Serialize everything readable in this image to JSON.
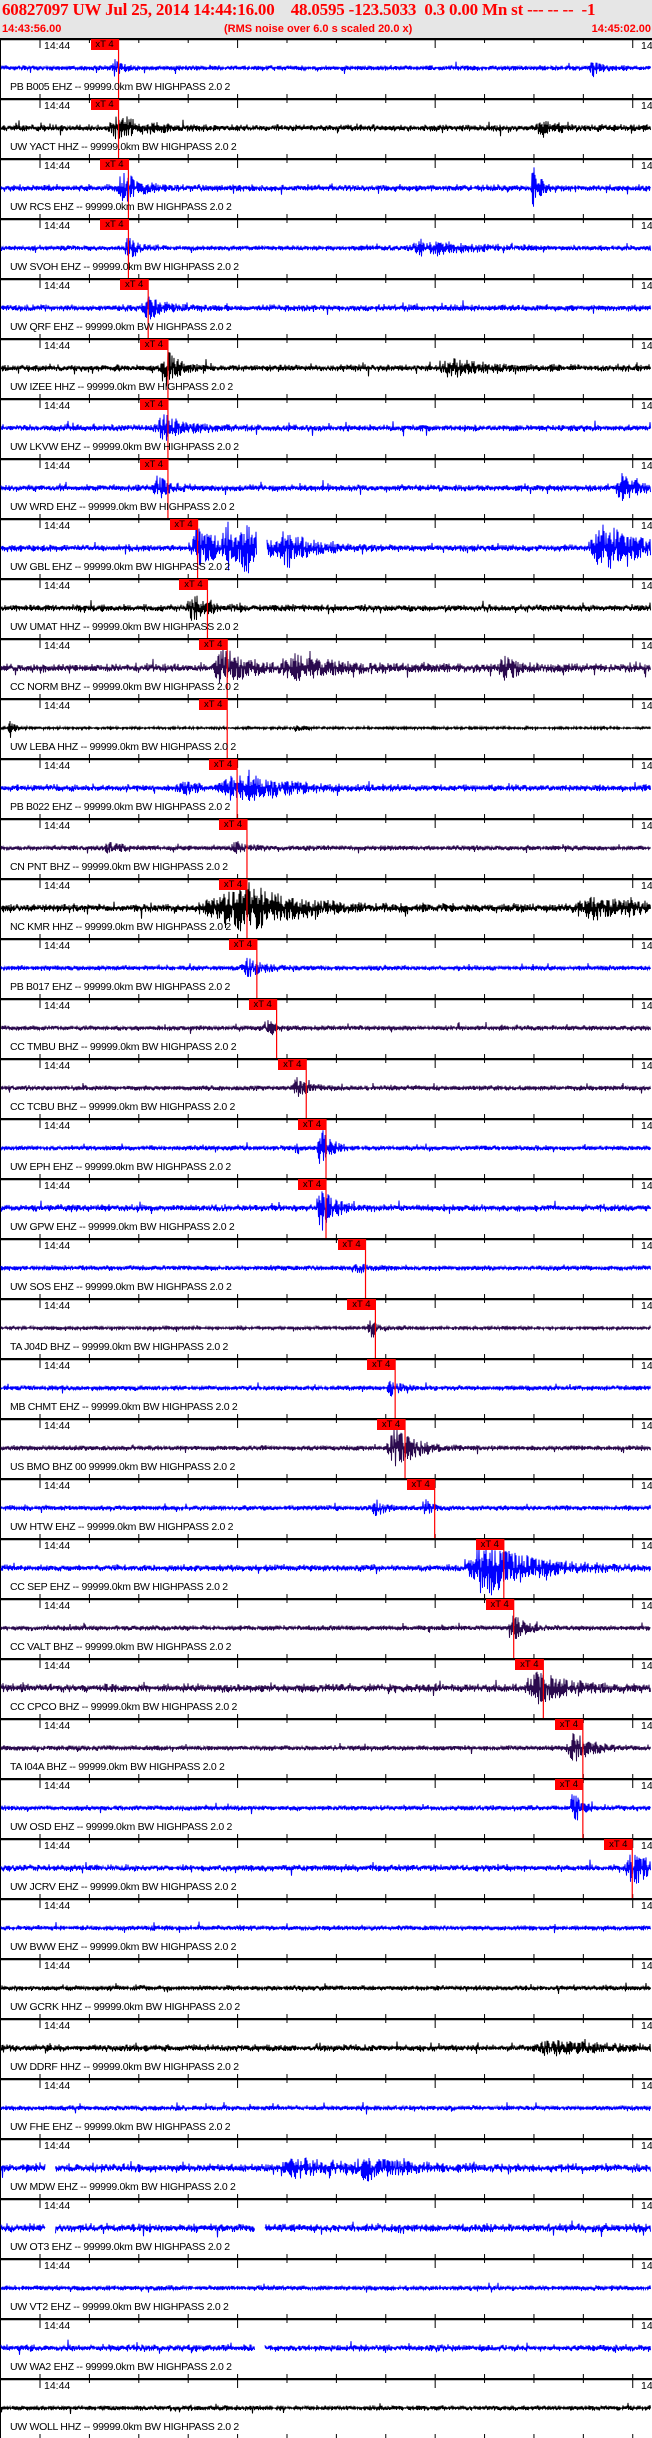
{
  "header": {
    "title": "60827097 UW Jul 25, 2014 14:44:16.00    48.0595 -123.5033  0.3 0.00 Mn st --- -- --  -1",
    "start_time": "14:43:56.00",
    "note": "(RMS noise over 6.0 s scaled 20.0 x)",
    "end_time": "14:45:02.00"
  },
  "colors": {
    "blue": "#0000ff",
    "black": "#000000",
    "purple": "#2a0a4e",
    "pick": "#ff0000",
    "header_bg": "#e6e6e6"
  },
  "chart_data": {
    "type": "line",
    "title": "60827097 UW Jul 25, 2014 14:44:16.00",
    "x_range_s": [
      0,
      66
    ],
    "x_start": "14:43:56.00",
    "x_end": "14:45:02.00",
    "tick_interval_s": 5,
    "tick_label": "14:44",
    "right_tick_label": "14:",
    "pick_label": "xT 4",
    "traces": [
      {
        "label": "PB B005 EHZ -- 99999.0km BW HIGHPASS 2.0 2",
        "color": "blue",
        "pick_s": 12,
        "noise": 3,
        "events": [
          [
            11.5,
            9,
            1
          ],
          [
            60,
            7,
            1
          ]
        ]
      },
      {
        "label": "UW YACT HHZ -- 99999.0km BW HIGHPASS 2.0 2",
        "color": "black",
        "pick_s": 12,
        "noise": 4,
        "events": [
          [
            12,
            11,
            3
          ],
          [
            55,
            6,
            2
          ]
        ]
      },
      {
        "label": "UW RCS EHZ -- 99999.0km BW HIGHPASS 2.0 2",
        "color": "blue",
        "pick_s": 13,
        "noise": 4,
        "events": [
          [
            12.5,
            14,
            2
          ],
          [
            54,
            22,
            0.8
          ]
        ]
      },
      {
        "label": "UW SVOH EHZ -- 99999.0km BW HIGHPASS 2.0 2",
        "color": "blue",
        "pick_s": 13,
        "noise": 3,
        "events": [
          [
            13,
            10,
            1.5
          ],
          [
            43,
            6,
            6
          ]
        ]
      },
      {
        "label": "UW QRF EHZ -- 99999.0km BW HIGHPASS 2.0 2",
        "color": "blue",
        "pick_s": 15,
        "noise": 4,
        "events": [
          [
            15,
            10,
            2
          ]
        ]
      },
      {
        "label": "UW IZEE HHZ -- 99999.0km BW HIGHPASS 2.0 2",
        "color": "black",
        "pick_s": 17,
        "noise": 4,
        "events": [
          [
            16.8,
            18,
            1.5
          ],
          [
            46,
            8,
            4
          ]
        ]
      },
      {
        "label": "UW LKVW EHZ -- 99999.0km BW HIGHPASS 2.0 2",
        "color": "blue",
        "pick_s": 17,
        "noise": 4,
        "events": [
          [
            16.5,
            12,
            2.5
          ]
        ]
      },
      {
        "label": "UW WRD EHZ -- 99999.0km BW HIGHPASS 2.0 2",
        "color": "blue",
        "pick_s": 17,
        "noise": 4,
        "events": [
          [
            16,
            11,
            1.5
          ],
          [
            63,
            12,
            2
          ]
        ]
      },
      {
        "label": "UW GBL EHZ -- 99999.0km BW HIGHPASS 2.0 2",
        "color": "blue",
        "pick_s": 20,
        "noise": 4,
        "events": [
          [
            20,
            25,
            2
          ],
          [
            23,
            20,
            2
          ],
          [
            25,
            22,
            2
          ],
          [
            29,
            15,
            3
          ],
          [
            61,
            25,
            4
          ]
        ],
        "gaps": [
          [
            26,
            27
          ]
        ]
      },
      {
        "label": "UW UMAT HHZ -- 99999.0km BW HIGHPASS 2.0 2",
        "color": "black",
        "pick_s": 21,
        "noise": 4,
        "events": [
          [
            19.5,
            13,
            2
          ]
        ]
      },
      {
        "label": "CC NORM BHZ -- 99999.0km BW HIGHPASS 2.0 2",
        "color": "purple",
        "pick_s": 23,
        "noise": 5,
        "events": [
          [
            22.5,
            18,
            3
          ],
          [
            30,
            10,
            5
          ],
          [
            51,
            10,
            2
          ]
        ]
      },
      {
        "label": "UW LEBA HHZ -- 99999.0km BW HIGHPASS 2.0 2",
        "color": "black",
        "pick_s": 23,
        "noise": 1.5,
        "events": [
          [
            1,
            10,
            0.5
          ],
          [
            30,
            3,
            1
          ]
        ]
      },
      {
        "label": "PB B022 EHZ -- 99999.0km BW HIGHPASS 2.0 2",
        "color": "blue",
        "pick_s": 24,
        "noise": 4,
        "events": [
          [
            18.5,
            6,
            2
          ],
          [
            24,
            14,
            5
          ]
        ]
      },
      {
        "label": "CN PNT BHZ -- 99999.0km BW HIGHPASS 2.0 2",
        "color": "purple",
        "pick_s": 25,
        "noise": 3,
        "events": [
          [
            11,
            5,
            2
          ],
          [
            24,
            5,
            2
          ]
        ]
      },
      {
        "label": "NC KMR HHZ -- 99999.0km BW HIGHPASS 2.0 2",
        "color": "black",
        "pick_s": 25,
        "noise": 5,
        "events": [
          [
            22,
            10,
            6
          ],
          [
            24.5,
            20,
            5
          ],
          [
            60,
            10,
            6
          ]
        ]
      },
      {
        "label": "PB B017 EHZ -- 99999.0km BW HIGHPASS 2.0 2",
        "color": "blue",
        "pick_s": 26,
        "noise": 3,
        "events": [
          [
            25,
            9,
            2
          ]
        ]
      },
      {
        "label": "CC TMBU BHZ -- 99999.0km BW HIGHPASS 2.0 2",
        "color": "purple",
        "pick_s": 28,
        "noise": 3,
        "events": [
          [
            27,
            9,
            1
          ]
        ]
      },
      {
        "label": "CC TCBU BHZ -- 99999.0km BW HIGHPASS 2.0 2",
        "color": "purple",
        "pick_s": 31,
        "noise": 3,
        "events": [
          [
            30,
            9,
            1.5
          ]
        ]
      },
      {
        "label": "UW EPH EHZ -- 99999.0km BW HIGHPASS 2.0 2",
        "color": "blue",
        "pick_s": 33,
        "noise": 3,
        "events": [
          [
            32.5,
            24,
            1
          ]
        ]
      },
      {
        "label": "UW GPW EHZ -- 99999.0km BW HIGHPASS 2.0 2",
        "color": "blue",
        "pick_s": 33,
        "noise": 4,
        "events": [
          [
            32.5,
            24,
            1.5
          ]
        ]
      },
      {
        "label": "UW SOS EHZ -- 99999.0km BW HIGHPASS 2.0 2",
        "color": "blue",
        "pick_s": 37,
        "noise": 3,
        "events": [
          [
            36,
            6,
            1.5
          ]
        ]
      },
      {
        "label": "TA J04D BHZ -- 99999.0km BW HIGHPASS 2.0 2",
        "color": "purple",
        "pick_s": 38,
        "noise": 2,
        "events": [
          [
            37.5,
            10,
            1
          ]
        ]
      },
      {
        "label": "MB CHMT EHZ -- 99999.0km BW HIGHPASS 2.0 2",
        "color": "blue",
        "pick_s": 40,
        "noise": 3,
        "events": [
          [
            39.5,
            8,
            1
          ]
        ]
      },
      {
        "label": "US BMO BHZ 00 99999.0km BW HIGHPASS 2.0 2",
        "color": "purple",
        "pick_s": 41,
        "noise": 3,
        "events": [
          [
            40,
            20,
            2.5
          ]
        ]
      },
      {
        "label": "UW HTW EHZ -- 99999.0km BW HIGHPASS 2.0 2",
        "color": "blue",
        "pick_s": 44,
        "noise": 3,
        "events": [
          [
            38,
            10,
            1
          ],
          [
            43,
            8,
            1
          ]
        ]
      },
      {
        "label": "CC SEP EHZ -- 99999.0km BW HIGHPASS 2.0 2",
        "color": "blue",
        "pick_s": 51,
        "noise": 4,
        "events": [
          [
            49,
            28,
            5
          ]
        ]
      },
      {
        "label": "CC VALT BHZ -- 99999.0km BW HIGHPASS 2.0 2",
        "color": "purple",
        "pick_s": 52,
        "noise": 3,
        "events": [
          [
            52,
            12,
            1.5
          ]
        ]
      },
      {
        "label": "CC CPCO BHZ -- 99999.0km BW HIGHPASS 2.0 2",
        "color": "purple",
        "pick_s": 55,
        "noise": 5,
        "events": [
          [
            54.5,
            14,
            4
          ]
        ]
      },
      {
        "label": "TA I04A BHZ -- 99999.0km BW HIGHPASS 2.0 2",
        "color": "purple",
        "pick_s": 59,
        "noise": 3,
        "events": [
          [
            58,
            15,
            2
          ]
        ]
      },
      {
        "label": "UW OSD EHZ -- 99999.0km BW HIGHPASS 2.0 2",
        "color": "blue",
        "pick_s": 59,
        "noise": 3,
        "events": [
          [
            58,
            20,
            0.8
          ]
        ]
      },
      {
        "label": "UW JCRV EHZ -- 99999.0km BW HIGHPASS 2.0 2",
        "color": "blue",
        "pick_s": 64,
        "noise": 4,
        "events": [
          [
            64,
            18,
            2
          ]
        ]
      },
      {
        "label": "UW BWW EHZ -- 99999.0km BW HIGHPASS 2.0 2",
        "color": "blue",
        "pick_s": null,
        "noise": 3,
        "events": []
      },
      {
        "label": "UW GCRK HHZ -- 99999.0km BW HIGHPASS 2.0 2",
        "color": "black",
        "pick_s": null,
        "noise": 3,
        "events": []
      },
      {
        "label": "UW DDRF HHZ -- 99999.0km BW HIGHPASS 2.0 2",
        "color": "black",
        "pick_s": null,
        "noise": 4,
        "events": [
          [
            56,
            6,
            6
          ]
        ]
      },
      {
        "label": "UW FHE EHZ -- 99999.0km BW HIGHPASS 2.0 2",
        "color": "blue",
        "pick_s": null,
        "noise": 3,
        "events": []
      },
      {
        "label": "UW MDW EHZ -- 99999.0km BW HIGHPASS 2.0 2",
        "color": "blue",
        "pick_s": null,
        "noise": 5,
        "events": [
          [
            30,
            8,
            6
          ],
          [
            37,
            9,
            4
          ]
        ],
        "gaps": [
          [
            4.6,
            5.6
          ]
        ]
      },
      {
        "label": "UW OT3 EHZ -- 99999.0km BW HIGHPASS 2.0 2",
        "color": "blue",
        "pick_s": null,
        "noise": 5,
        "events": [],
        "gaps": [
          [
            4.6,
            5.6
          ],
          [
            25.8,
            26.8
          ]
        ]
      },
      {
        "label": "UW VT2 EHZ -- 99999.0km BW HIGHPASS 2.0 2",
        "color": "blue",
        "pick_s": null,
        "noise": 3,
        "events": []
      },
      {
        "label": "UW WA2 EHZ -- 99999.0km BW HIGHPASS 2.0 2",
        "color": "blue",
        "pick_s": null,
        "noise": 4,
        "events": [],
        "gaps": [
          [
            25.8,
            26.8
          ]
        ]
      },
      {
        "label": "UW WOLL HHZ -- 99999.0km BW HIGHPASS 2.0 2",
        "color": "black",
        "pick_s": null,
        "noise": 3,
        "events": []
      }
    ]
  }
}
